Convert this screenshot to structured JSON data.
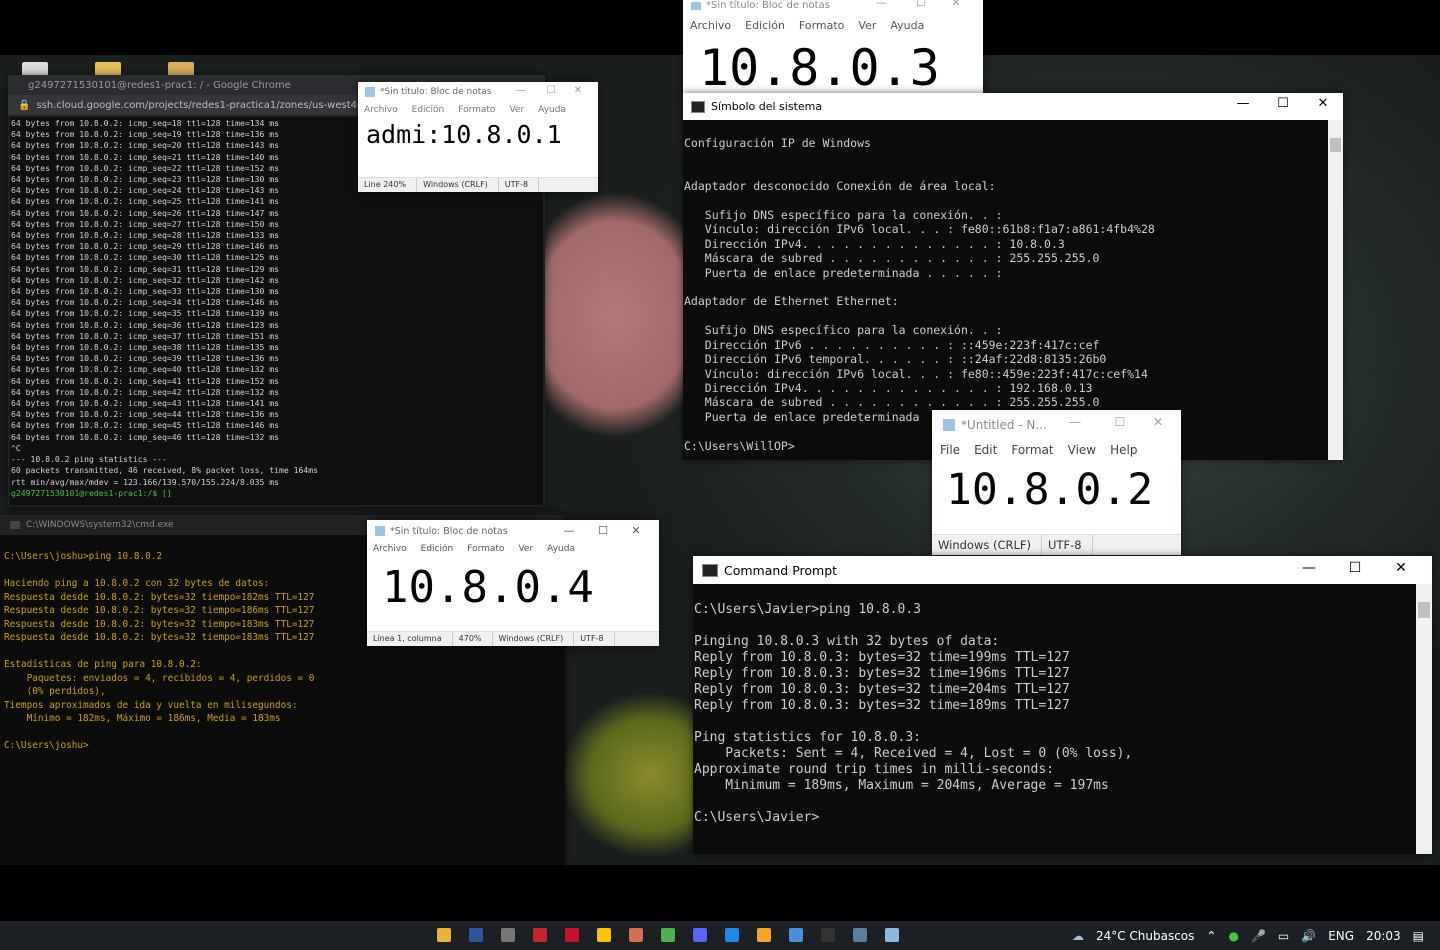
{
  "chrome": {
    "title": "g2497271530101@redes1-prac1: / - Google Chrome",
    "address": "ssh.cloud.google.com/projects/redes1-practica1/zones/us-west4-b/in",
    "terminal_lines": [
      "64 bytes from 10.8.0.2: icmp_seq=18 ttl=128 time=134 ms",
      "64 bytes from 10.8.0.2: icmp_seq=19 ttl=128 time=136 ms",
      "64 bytes from 10.8.0.2: icmp_seq=20 ttl=128 time=143 ms",
      "64 bytes from 10.8.0.2: icmp_seq=21 ttl=128 time=140 ms",
      "64 bytes from 10.8.0.2: icmp_seq=22 ttl=128 time=152 ms",
      "64 bytes from 10.8.0.2: icmp_seq=23 ttl=128 time=130 ms",
      "64 bytes from 10.8.0.2: icmp_seq=24 ttl=128 time=143 ms",
      "64 bytes from 10.8.0.2: icmp_seq=25 ttl=128 time=141 ms",
      "64 bytes from 10.8.0.2: icmp_seq=26 ttl=128 time=147 ms",
      "64 bytes from 10.8.0.2: icmp_seq=27 ttl=128 time=150 ms",
      "64 bytes from 10.8.0.2: icmp_seq=28 ttl=128 time=133 ms",
      "64 bytes from 10.8.0.2: icmp_seq=29 ttl=128 time=146 ms",
      "64 bytes from 10.8.0.2: icmp_seq=30 ttl=128 time=125 ms",
      "64 bytes from 10.8.0.2: icmp_seq=31 ttl=128 time=129 ms",
      "64 bytes from 10.8.0.2: icmp_seq=32 ttl=128 time=142 ms",
      "64 bytes from 10.8.0.2: icmp_seq=33 ttl=128 time=130 ms",
      "64 bytes from 10.8.0.2: icmp_seq=34 ttl=128 time=146 ms",
      "64 bytes from 10.8.0.2: icmp_seq=35 ttl=128 time=139 ms",
      "64 bytes from 10.8.0.2: icmp_seq=36 ttl=128 time=123 ms",
      "64 bytes from 10.8.0.2: icmp_seq=37 ttl=128 time=151 ms",
      "64 bytes from 10.8.0.2: icmp_seq=38 ttl=128 time=135 ms",
      "64 bytes from 10.8.0.2: icmp_seq=39 ttl=128 time=136 ms",
      "64 bytes from 10.8.0.2: icmp_seq=40 ttl=128 time=132 ms",
      "64 bytes from 10.8.0.2: icmp_seq=41 ttl=128 time=152 ms",
      "64 bytes from 10.8.0.2: icmp_seq=42 ttl=128 time=132 ms",
      "64 bytes from 10.8.0.2: icmp_seq=43 ttl=128 time=141 ms",
      "64 bytes from 10.8.0.2: icmp_seq=44 ttl=128 time=136 ms",
      "64 bytes from 10.8.0.2: icmp_seq=45 ttl=128 time=146 ms",
      "64 bytes from 10.8.0.2: icmp_seq=46 ttl=128 time=132 ms",
      "^C",
      "--- 10.8.0.2 ping statistics ---",
      "60 packets transmitted, 46 received, 8% packet loss, time 164ms",
      "rtt min/avg/max/mdev = 123.166/139.570/155.224/8.035 ms"
    ],
    "prompt": "g2497271530101@redes1-prac1:/$ []"
  },
  "cmd_joshu": {
    "title": "C:\\WINDOWS\\system32\\cmd.exe",
    "text": "C:\\Users\\joshu>ping 10.8.0.2\n\nHaciendo ping a 10.8.0.2 con 32 bytes de datos:\nRespuesta desde 10.8.0.2: bytes=32 tiempo=182ms TTL=127\nRespuesta desde 10.8.0.2: bytes=32 tiempo=186ms TTL=127\nRespuesta desde 10.8.0.2: bytes=32 tiempo=183ms TTL=127\nRespuesta desde 10.8.0.2: bytes=32 tiempo=183ms TTL=127\n\nEstadísticas de ping para 10.8.0.2:\n    Paquetes: enviados = 4, recibidos = 4, perdidos = 0\n    (0% perdidos),\nTiempos aproximados de ida y vuelta en milisegundos:\n    Mínimo = 182ms, Máximo = 186ms, Media = 183ms\n\nC:\\Users\\joshu>"
  },
  "notepad_admi": {
    "title": "*Sin título: Bloc de notas",
    "menu": [
      "Archivo",
      "Edición",
      "Formato",
      "Ver",
      "Ayuda"
    ],
    "content": "admi:10.8.0.1",
    "status": [
      "Line 240%",
      "Windows (CRLF)",
      "UTF-8"
    ]
  },
  "notepad_top": {
    "title": "*Sin título: Bloc de notas",
    "menu": [
      "Archivo",
      "Edición",
      "Formato",
      "Ver",
      "Ayuda"
    ],
    "content": "10.8.0.3"
  },
  "notepad_104": {
    "title": "*Sin título: Bloc de notas",
    "menu": [
      "Archivo",
      "Edición",
      "Formato",
      "Ver",
      "Ayuda"
    ],
    "content": "10.8.0.4",
    "status": [
      "Línea 1, columna",
      "470%",
      "Windows (CRLF)",
      "UTF-8"
    ]
  },
  "notepad_102": {
    "title": "*Untitled - N...",
    "menu": [
      "File",
      "Edit",
      "Format",
      "View",
      "Help"
    ],
    "content": "10.8.0.2",
    "status": [
      "Windows (CRLF)",
      "UTF-8"
    ]
  },
  "simbolo": {
    "title": "Símbolo del sistema",
    "text": "Configuración IP de Windows\n\n\nAdaptador desconocido Conexión de área local:\n\n   Sufijo DNS específico para la conexión. . :\n   Vínculo: dirección IPv6 local. . . : fe80::61b8:f1a7:a861:4fb4%28\n   Dirección IPv4. . . . . . . . . . . . . . : 10.8.0.3\n   Máscara de subred . . . . . . . . . . . . : 255.255.255.0\n   Puerta de enlace predeterminada . . . . . :\n\nAdaptador de Ethernet Ethernet:\n\n   Sufijo DNS específico para la conexión. . :\n   Dirección IPv6 . . . . . . . . . . : ::459e:223f:417c:cef\n   Dirección IPv6 temporal. . . . . . : ::24af:22d8:8135:26b0\n   Vínculo: dirección IPv6 local. . . : fe80::459e:223f:417c:cef%14\n   Dirección IPv4. . . . . . . . . . . . . . : 192.168.0.13\n   Máscara de subred . . . . . . . . . . . . : 255.255.255.0\n   Puerta de enlace predeterminada\n\nC:\\Users\\WillOP>"
  },
  "cmd_javier": {
    "title": "Command Prompt",
    "text": "C:\\Users\\Javier>ping 10.8.0.3\n\nPinging 10.8.0.3 with 32 bytes of data:\nReply from 10.8.0.3: bytes=32 time=199ms TTL=127\nReply from 10.8.0.3: bytes=32 time=196ms TTL=127\nReply from 10.8.0.3: bytes=32 time=204ms TTL=127\nReply from 10.8.0.3: bytes=32 time=189ms TTL=127\n\nPing statistics for 10.8.0.3:\n    Packets: Sent = 4, Received = 4, Lost = 0 (0% loss),\nApproximate round trip times in milli-seconds:\n    Minimum = 189ms, Maximum = 204ms, Average = 197ms\n\nC:\\Users\\Javier>"
  },
  "taskbar": {
    "weather": "24°C  Chubascos",
    "lang": "ENG",
    "time": "20:03",
    "apps": [
      "file-explorer-icon",
      "word-icon",
      "store-icon",
      "app-red-icon",
      "illustrator-icon",
      "sticky-notes-icon",
      "paint-icon",
      "chrome-icon",
      "discord-icon",
      "vpn-icon",
      "app-circle-icon",
      "remote-icon",
      "cmd-icon",
      "network-icon",
      "notepad-icon"
    ]
  },
  "colors": {
    "cmd_bg": "#0c0c0c",
    "cmd_text": "#cccccc",
    "yellow_text": "#c8a010",
    "green_prompt": "#3ec83e",
    "notepad_bg": "#ffffff",
    "titlebar_light": "#ffffff"
  }
}
